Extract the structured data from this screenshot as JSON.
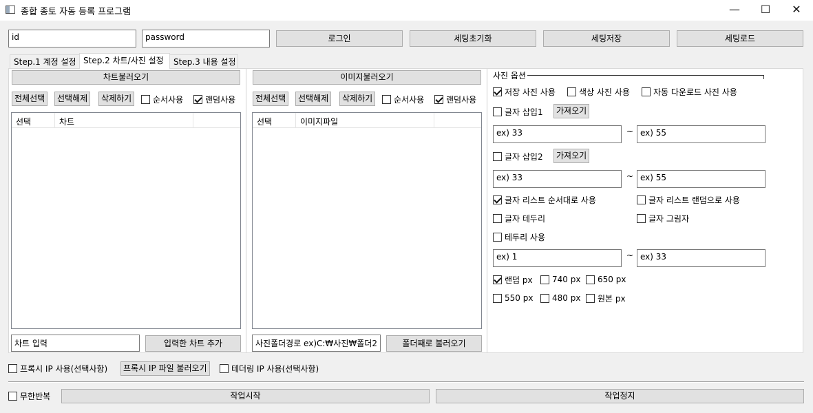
{
  "window": {
    "title": "종합 종토 자동 등록 프로그램",
    "minimize": "—",
    "maximize": "☐",
    "close": "✕"
  },
  "login": {
    "id_value": "id",
    "password_value": "password",
    "login_label": "로그인",
    "reset_label": "세팅초기화",
    "save_label": "세팅저장",
    "load_label": "세팅로드"
  },
  "tabs": [
    {
      "label": "Step.1 계정 설정"
    },
    {
      "label": "Step.2 차트/사진 설정"
    },
    {
      "label": "Step.3 내용 설정"
    }
  ],
  "chart_panel": {
    "load_label": "차트불러오기",
    "select_all": "전체선택",
    "deselect": "선택해제",
    "delete": "삭제하기",
    "sequential": "순서사용",
    "random": "랜덤사용",
    "columns": [
      "선택",
      "차트"
    ],
    "input_value": "차트 입력",
    "add_label": "입력한 차트 추가"
  },
  "image_panel": {
    "load_label": "이미지불러오기",
    "select_all": "전체선택",
    "deselect": "선택해제",
    "delete": "삭제하기",
    "sequential": "순서사용",
    "random": "랜덤사용",
    "columns": [
      "선택",
      "이미지파일"
    ],
    "path_value": "사진폴더경로 ex)C:₩사진₩폴더2",
    "folder_label": "폴더째로 불러오기"
  },
  "photo_options": {
    "group_title": "사진 옵션",
    "saved_photo": "저장 사진 사용",
    "color_photo": "색상 사진 사용",
    "auto_download": "자동 다운로드 사진 사용",
    "text_insert1": "글자 삽입1",
    "fetch1": "가져오기",
    "range1_from": "ex) 33",
    "range1_to": "ex) 55",
    "text_insert2": "글자 삽입2",
    "fetch2": "가져오기",
    "range2_from": "ex) 33",
    "range2_to": "ex) 55",
    "list_order": "글자 리스트 순서대로 사용",
    "list_random": "글자 리스트 랜덤으로 사용",
    "text_border": "글자 테두리",
    "text_shadow": "글자 그림자",
    "border_use": "테두리 사용",
    "range3_from": "ex) 1",
    "range3_to": "ex) 33",
    "tilde": "~",
    "size_random": "랜덤 px",
    "size_740": "740 px",
    "size_650": "650 px",
    "size_550": "550 px",
    "size_480": "480 px",
    "size_original": "원본 px"
  },
  "bottom": {
    "proxy_use": "프록시 IP 사용(선택사항)",
    "proxy_load": "프록시 IP 파일 불러오기",
    "tethering": "테더링 IP 사용(선택사항)",
    "infinite": "무한반복",
    "start": "작업시작",
    "stop": "작업정지"
  }
}
